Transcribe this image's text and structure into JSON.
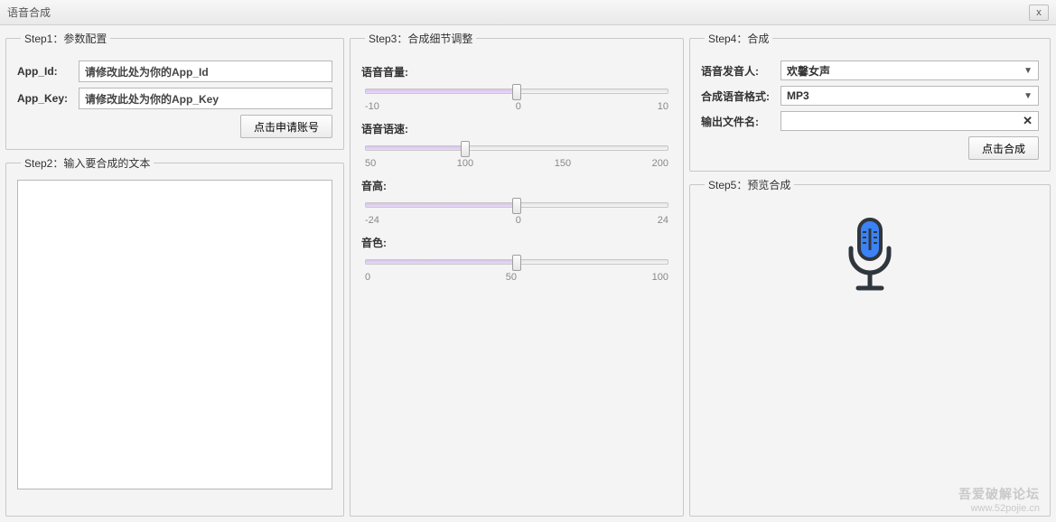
{
  "window": {
    "title": "语音合成",
    "close_label": "x"
  },
  "step1": {
    "legend": "Step1：参数配置",
    "app_id_label": "App_Id:",
    "app_id_value": "请修改此处为你的App_Id",
    "app_key_label": "App_Key:",
    "app_key_value": "请修改此处为你的App_Key",
    "request_button": "点击申请账号"
  },
  "step2": {
    "legend": "Step2：输入要合成的文本",
    "text_value": ""
  },
  "step3": {
    "legend": "Step3：合成细节调整",
    "volume": {
      "label": "语音音量:",
      "min": -10,
      "mid": 0,
      "max": 10,
      "value": 0
    },
    "speed": {
      "label": "语音语速:",
      "min": 50,
      "mid": 100,
      "mid2": 150,
      "max": 200,
      "value": 100
    },
    "pitch": {
      "label": "音高:",
      "min": -24,
      "mid": 0,
      "max": 24,
      "value": 0
    },
    "timbre": {
      "label": "音色:",
      "min": 0,
      "mid": 50,
      "max": 100,
      "value": 50
    }
  },
  "step4": {
    "legend": "Step4：合成",
    "speaker_label": "语音发音人:",
    "speaker_value": "欢馨女声",
    "format_label": "合成语音格式:",
    "format_value": "MP3",
    "output_label": "输出文件名:",
    "output_value": "",
    "synth_button": "点击合成"
  },
  "step5": {
    "legend": "Step5：预览合成"
  },
  "watermark": {
    "line1": "吾爱破解论坛",
    "line2": "www.52pojie.cn"
  }
}
